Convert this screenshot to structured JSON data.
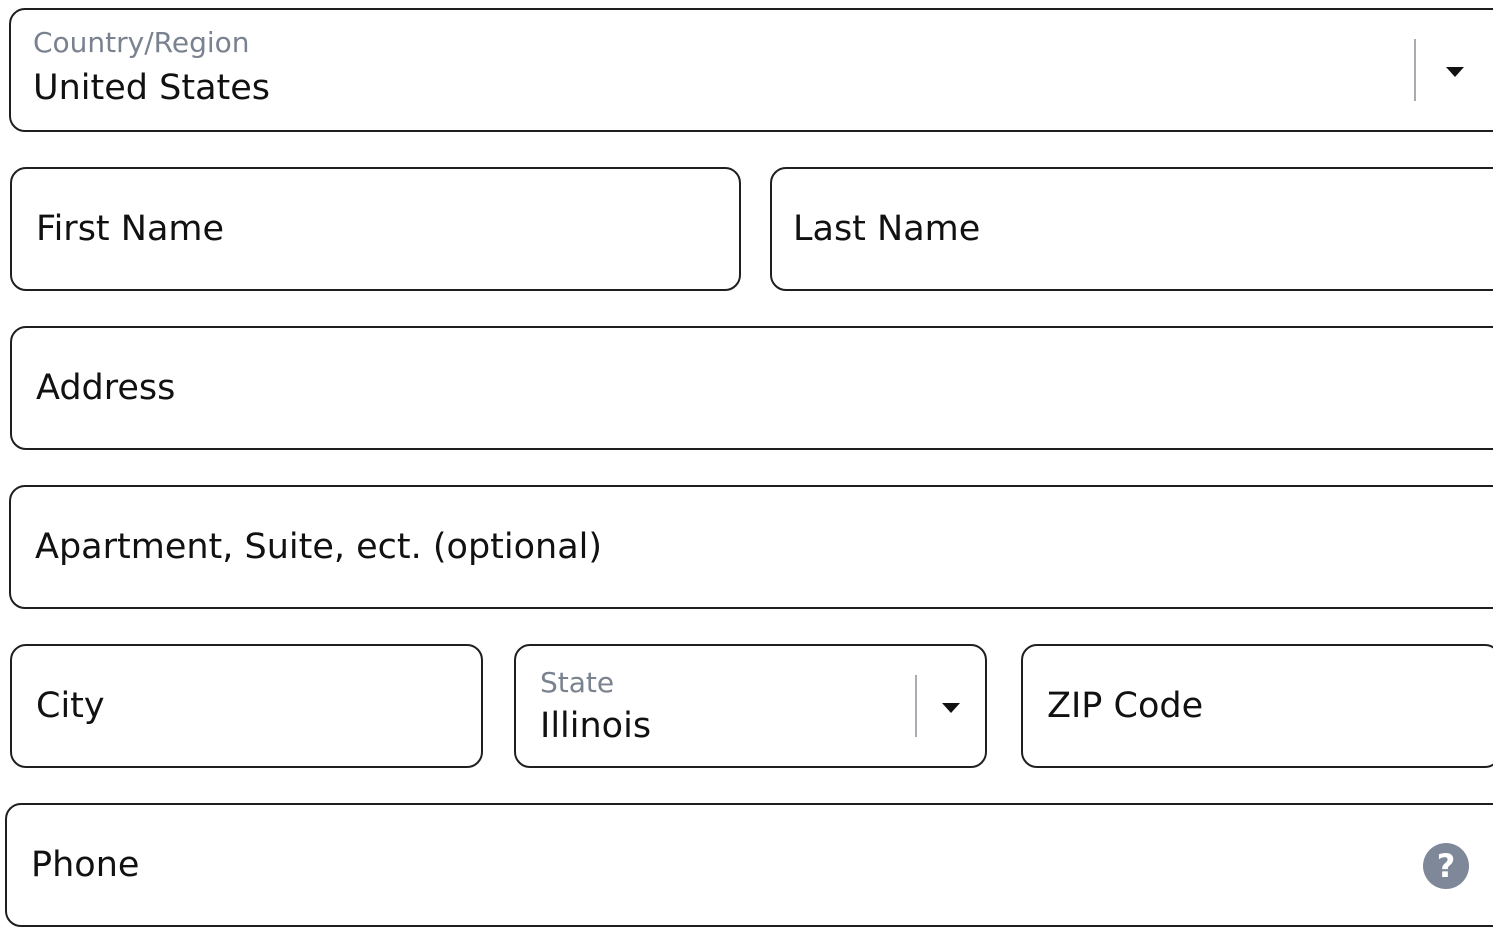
{
  "form": {
    "country": {
      "label": "Country/Region",
      "value": "United States"
    },
    "first_name_placeholder": "First Name",
    "last_name_placeholder": "Last Name",
    "address_placeholder": "Address",
    "apartment_placeholder": "Apartment, Suite, ect. (optional)",
    "city_placeholder": "City",
    "state": {
      "label": "State",
      "value": "Illinois"
    },
    "zip_placeholder": "ZIP Code",
    "phone_placeholder": "Phone",
    "phone_help_glyph": "?"
  },
  "icons": {
    "dropdown": "chevron-down-icon",
    "help": "help-circle-icon"
  },
  "colors": {
    "border": "#1f1f1f",
    "floating_label": "#7a8290",
    "help_bg": "#7f8898"
  }
}
